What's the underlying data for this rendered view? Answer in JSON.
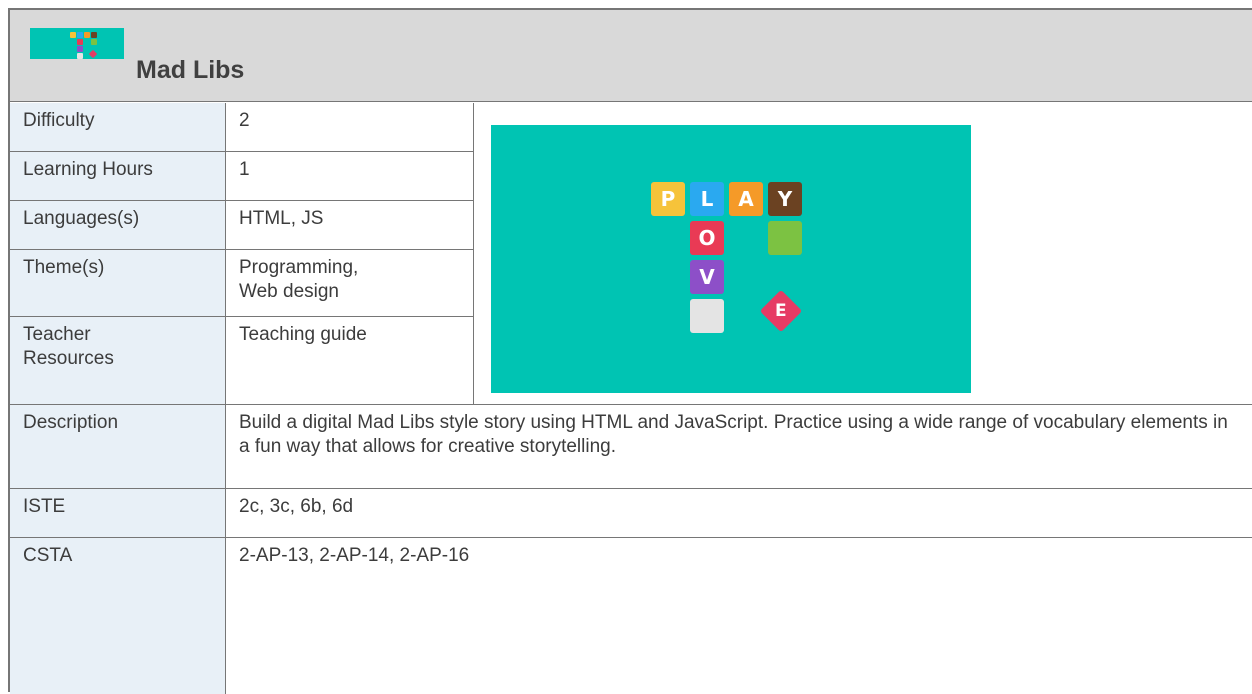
{
  "header": {
    "title": "Mad Libs"
  },
  "promo": {
    "tiles": [
      "P",
      "L",
      "A",
      "Y",
      "O",
      "V",
      "E"
    ]
  },
  "rows": {
    "difficulty": {
      "label": "Difficulty",
      "value": "2"
    },
    "hours": {
      "label": "Learning Hours",
      "value": "1"
    },
    "languages": {
      "label": "Languages(s)",
      "value": "HTML, JS"
    },
    "themes": {
      "label": "Theme(s)",
      "value_line1": "Programming,",
      "value_line2": "Web design"
    },
    "resources": {
      "label_line1": "Teacher",
      "label_line2": "Resources",
      "value": "Teaching guide"
    },
    "description": {
      "label": "Description",
      "value": "Build a digital Mad Libs style story using HTML and JavaScript. Practice using a wide range of vocabulary elements in a fun way that allows for creative storytelling."
    },
    "iste": {
      "label": "ISTE",
      "value": "2c, 3c, 6b, 6d"
    },
    "csta": {
      "label": "CSTA",
      "value": "2-AP-13, 2-AP-14, 2-AP-16"
    }
  },
  "colors": {
    "teal": "#00c4b3",
    "label_bg": "#e8f0f7",
    "header_bg": "#d9d9d9",
    "tile_yellow": "#f6c33a",
    "tile_blue": "#2aa9f0",
    "tile_orange": "#f59a28",
    "tile_brown": "#6b4222",
    "tile_red": "#e93a55",
    "tile_purple": "#8d4fc8",
    "tile_green": "#7cc242",
    "tile_gray": "#e4e4e4",
    "tile_pink": "#e63b64"
  }
}
